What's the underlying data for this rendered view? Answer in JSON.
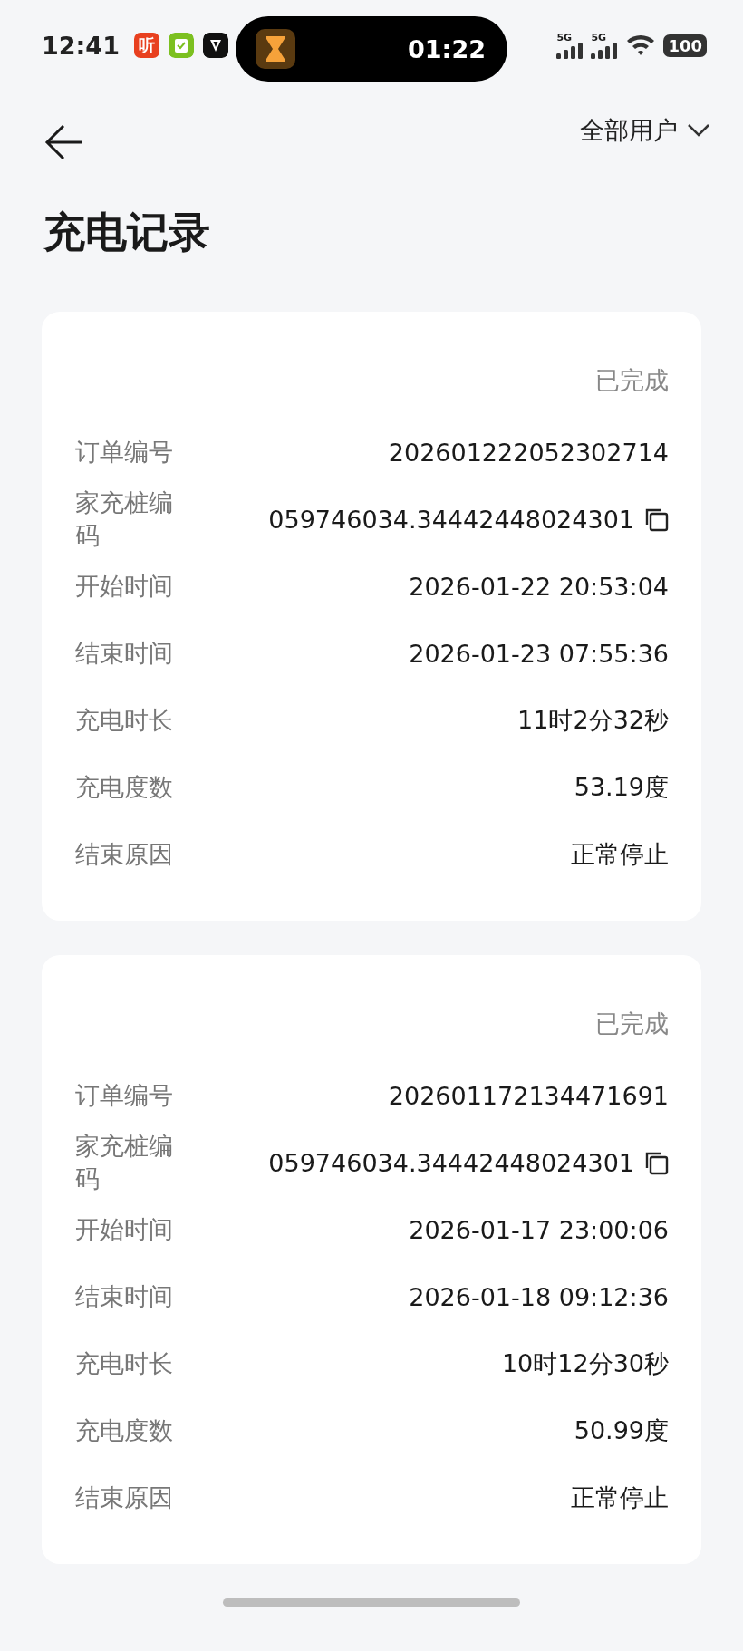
{
  "status_bar": {
    "time": "12:41",
    "app_icon_text": "听",
    "timer": "01:22",
    "signals": [
      "5G",
      "5G"
    ],
    "battery": "100"
  },
  "header": {
    "filter": "全部用户",
    "title": "充电记录"
  },
  "records": [
    {
      "status": "已完成",
      "rows": [
        {
          "label": "订单编号",
          "value": "202601222052302714",
          "copyable": false
        },
        {
          "label": "家充桩编码",
          "value": "059746034.34442448024301",
          "copyable": true
        },
        {
          "label": "开始时间",
          "value": "2026-01-22 20:53:04",
          "copyable": false
        },
        {
          "label": "结束时间",
          "value": "2026-01-23 07:55:36",
          "copyable": false
        },
        {
          "label": "充电时长",
          "value": "11时2分32秒",
          "copyable": false
        },
        {
          "label": "充电度数",
          "value": "53.19度",
          "copyable": false
        },
        {
          "label": "结束原因",
          "value": "正常停止",
          "copyable": false
        }
      ]
    },
    {
      "status": "已完成",
      "rows": [
        {
          "label": "订单编号",
          "value": "202601172134471691",
          "copyable": false
        },
        {
          "label": "家充桩编码",
          "value": "059746034.34442448024301",
          "copyable": true
        },
        {
          "label": "开始时间",
          "value": "2026-01-17 23:00:06",
          "copyable": false
        },
        {
          "label": "结束时间",
          "value": "2026-01-18 09:12:36",
          "copyable": false
        },
        {
          "label": "充电时长",
          "value": "10时12分30秒",
          "copyable": false
        },
        {
          "label": "充电度数",
          "value": "50.99度",
          "copyable": false
        },
        {
          "label": "结束原因",
          "value": "正常停止",
          "copyable": false
        }
      ]
    }
  ]
}
